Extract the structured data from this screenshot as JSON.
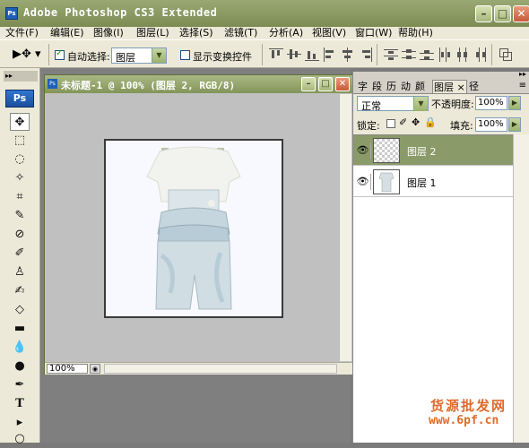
{
  "window": {
    "title": "Adobe Photoshop CS3 Extended"
  },
  "menu": [
    "文件(F)",
    "编辑(E)",
    "图像(I)",
    "图层(L)",
    "选择(S)",
    "滤镜(T)",
    "分析(A)",
    "视图(V)",
    "窗口(W)",
    "帮助(H)"
  ],
  "options": {
    "auto_select_label": "自动选择:",
    "auto_select_value": "图层",
    "show_transform_label": "显示变换控件"
  },
  "document": {
    "title": "未标题-1 @ 100% (图层 2, RGB/8)",
    "zoom": "100%"
  },
  "toolbar": {
    "logo": "Ps"
  },
  "layers_panel": {
    "tabs": [
      "字",
      "段",
      "历",
      "动",
      "颜",
      "图层",
      "径"
    ],
    "blend_mode": "正常",
    "opacity_label": "不透明度:",
    "opacity_value": "100%",
    "lock_label": "锁定:",
    "fill_label": "填充:",
    "fill_value": "100%",
    "layers": [
      {
        "name": "图层 2",
        "selected": true,
        "thumb": "transparent"
      },
      {
        "name": "图层 1",
        "selected": false,
        "thumb": "dress"
      }
    ]
  },
  "watermark": {
    "line1": "货源批发网",
    "line2": "www.6pf.cn"
  }
}
